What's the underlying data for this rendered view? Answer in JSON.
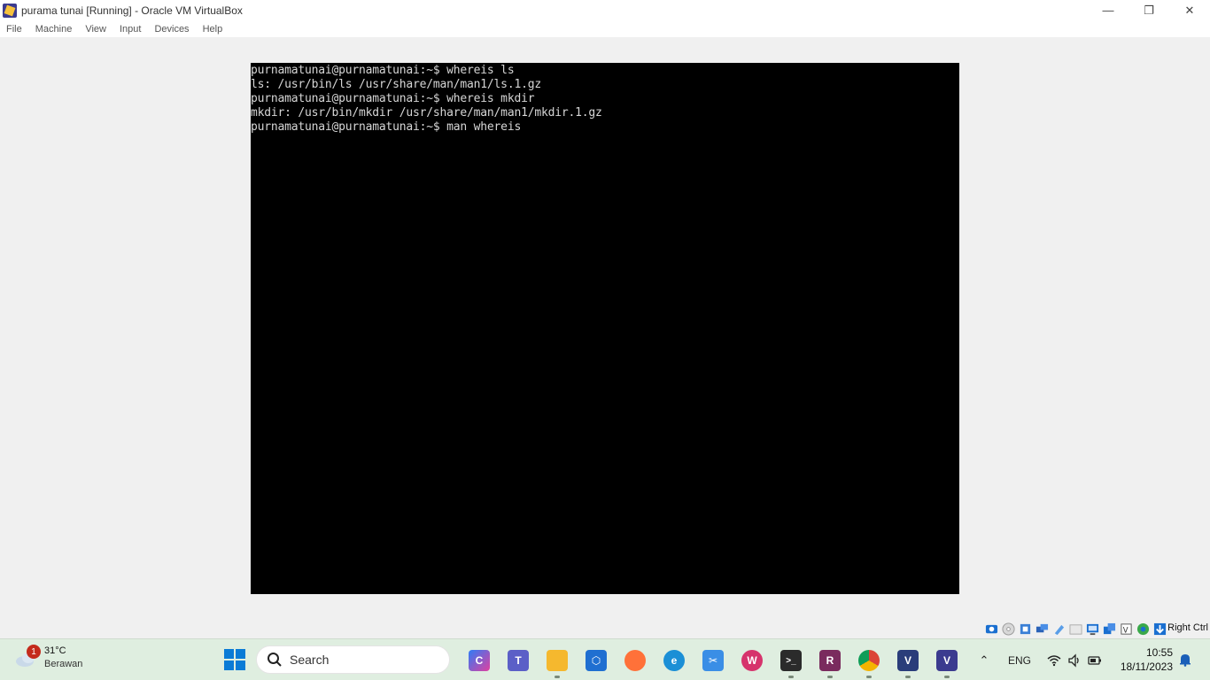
{
  "window": {
    "title": "purama tunai [Running] - Oracle VM VirtualBox",
    "controls": {
      "minimize": "—",
      "restore": "❐",
      "close": "✕"
    }
  },
  "menu": [
    {
      "label": "File"
    },
    {
      "label": "Machine"
    },
    {
      "label": "View"
    },
    {
      "label": "Input"
    },
    {
      "label": "Devices"
    },
    {
      "label": "Help"
    }
  ],
  "console": {
    "lines": [
      "purnamatunai@purnamatunai:~$ whereis ls",
      "ls: /usr/bin/ls /usr/share/man/man1/ls.1.gz",
      "purnamatunai@purnamatunai:~$ whereis mkdir",
      "mkdir: /usr/bin/mkdir /usr/share/man/man1/mkdir.1.gz",
      "purnamatunai@purnamatunai:~$ man whereis"
    ],
    "background": "#000000",
    "foreground": "#d6d6d6"
  },
  "statusbar": {
    "icons": [
      "hard-disk-icon",
      "optical-drive-icon",
      "audio-icon",
      "network-icon",
      "usb-icon",
      "shared-folders-icon",
      "display-icon",
      "video-capture-icon",
      "recording-icon",
      "cpu-icon",
      "mouse-integration-icon"
    ],
    "host_key": "Right Ctrl"
  },
  "taskbar": {
    "weather": {
      "temp": "31°C",
      "desc": "Berawan",
      "badge": "1"
    },
    "search_label": "Search",
    "apps": [
      {
        "name": "copilot-icon",
        "color": "#2f7cf6",
        "glyph": "C"
      },
      {
        "name": "teams-icon",
        "color": "#5b5fc7",
        "glyph": "T"
      },
      {
        "name": "file-explorer-icon",
        "color": "#f5b82e",
        "glyph": ""
      },
      {
        "name": "dev-tool-icon",
        "color": "#1f6fd1",
        "glyph": "⬡"
      },
      {
        "name": "firefox-icon",
        "color": "#ff7139",
        "glyph": ""
      },
      {
        "name": "edge-icon",
        "color": "#1b8fd6",
        "glyph": "e"
      },
      {
        "name": "snipping-tool-icon",
        "color": "#3a8ee6",
        "glyph": "✂"
      },
      {
        "name": "wps-office-icon",
        "color": "#d6336c",
        "glyph": "W"
      },
      {
        "name": "terminal-icon",
        "color": "#2b2b2b",
        "glyph": ">_"
      },
      {
        "name": "winrar-icon",
        "color": "#7a2b5e",
        "glyph": "R"
      },
      {
        "name": "chrome-icon",
        "color": "#db4437",
        "glyph": ""
      },
      {
        "name": "virtualbox-icon",
        "color": "#2a3d7a",
        "glyph": "V"
      },
      {
        "name": "virtualbox-vm-icon",
        "color": "#3b3b8f",
        "glyph": "V"
      }
    ],
    "tray": {
      "chevron": "⌃",
      "lang": "ENG"
    },
    "clock": {
      "time": "10:55",
      "date": "18/11/2023"
    }
  }
}
